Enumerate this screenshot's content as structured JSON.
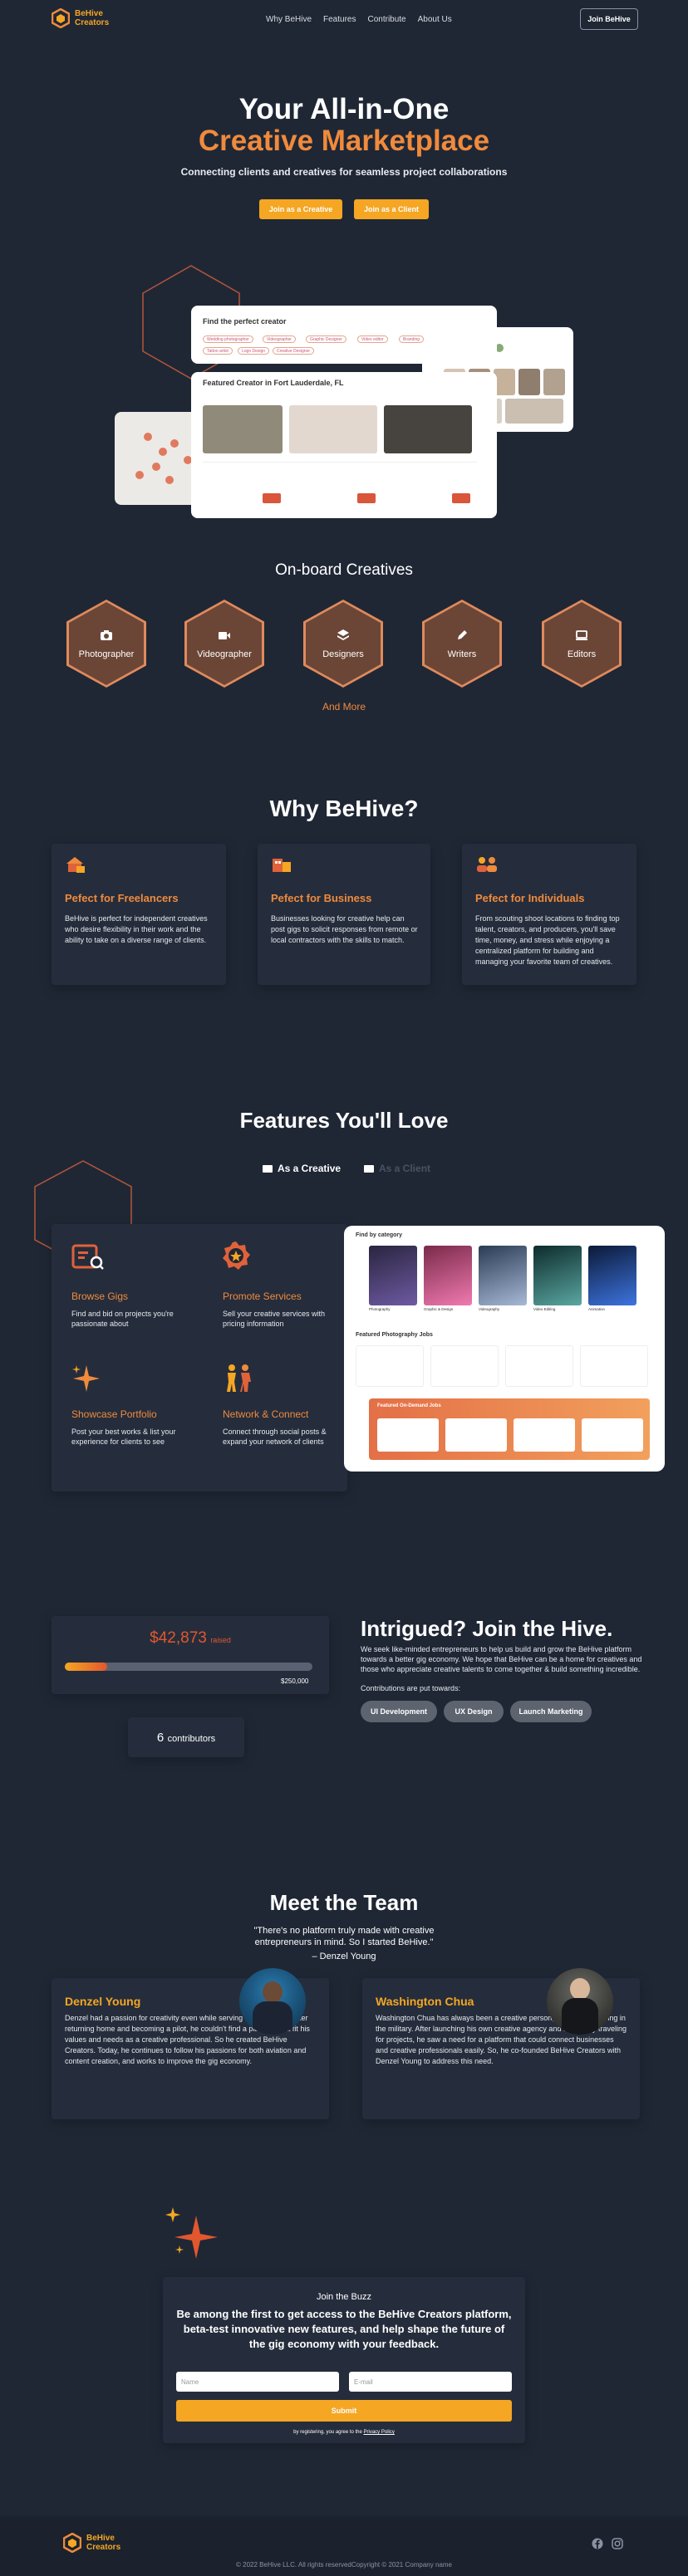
{
  "nav": {
    "brand_line1": "BeHive",
    "brand_line2": "Creators",
    "links": [
      "Why BeHive",
      "Features",
      "Contribute",
      "About Us"
    ],
    "join_label": "Join BeHive"
  },
  "hero": {
    "title_line1": "Your All-in-One",
    "title_line2": "Creative Marketplace",
    "subtitle": "Connecting clients and creatives for seamless project collaborations",
    "btn_creative": "Join as a Creative",
    "btn_client": "Join as a Client",
    "mock_search_title": "Find the perfect creator",
    "mock_featured_title": "Featured Creator in Fort Lauderdale, FL",
    "chips": [
      "Wedding photographer",
      "Videographer",
      "Graphic Designer",
      "Video editor",
      "Branding",
      "Tattoo artist",
      "Logo Design",
      "Creative Designer"
    ]
  },
  "onboard": {
    "title": "On-board Creatives",
    "items": [
      {
        "label": "Photographer",
        "icon": "camera-icon"
      },
      {
        "label": "Videographer",
        "icon": "video-icon"
      },
      {
        "label": "Designers",
        "icon": "layers-icon"
      },
      {
        "label": "Writers",
        "icon": "pencil-icon"
      },
      {
        "label": "Editors",
        "icon": "monitor-icon"
      }
    ],
    "more": "And More"
  },
  "why": {
    "title": "Why BeHive?",
    "cards": [
      {
        "title": "Pefect for Freelancers",
        "text": "BeHive is perfect for independent creatives who desire flexibility in their work and the ability to take on a diverse range of clients."
      },
      {
        "title": "Pefect for Business",
        "text": "Businesses looking for creative help can post gigs to solicit responses from remote or local contractors with the skills to match."
      },
      {
        "title": "Pefect for Individuals",
        "text": "From scouting shoot locations to finding top talent, creators, and producers, you'll save time, money, and stress while enjoying a centralized platform for building and managing your favorite team of creatives."
      }
    ]
  },
  "features": {
    "title": "Features You'll Love",
    "tab_creative": "As a Creative",
    "tab_client": "As a Client",
    "items": [
      {
        "title": "Browse Gigs",
        "text": "Find and bid on projects you're passionate about"
      },
      {
        "title": "Promote Services",
        "text": "Sell your creative services with pricing information"
      },
      {
        "title": "Showcase Portfolio",
        "text": "Post your best works & list your experience for clients to see"
      },
      {
        "title": "Network & Connect",
        "text": "Connect through social posts & expand your network of clients"
      }
    ],
    "mock": {
      "category_title": "Find by category",
      "categories": [
        "Photography",
        "Graphic & Design",
        "Videography",
        "Video Editing",
        "Animation"
      ],
      "jobs_title": "Featured Photography Jobs",
      "banner_title": "Featured On-Demand Jobs"
    }
  },
  "raise": {
    "amount": "$42,873",
    "raised_label": "raised",
    "goal": "$250,000",
    "progress": 0.17,
    "contributors_count": "6",
    "contributors_label": "contributors"
  },
  "join": {
    "title": "Intrigued? Join the Hive.",
    "text": "We seek like-minded entrepreneurs to help us build and grow the BeHive platform towards a better gig economy. We hope that BeHive can be a home for creatives and those who appreciate creative talents to come together & build something incredible.",
    "contrib_label": "Contributions are put towards:",
    "pills": [
      "UI Development",
      "UX Design",
      "Launch Marketing"
    ]
  },
  "team": {
    "title": "Meet the Team",
    "quote": "\"There's no platform truly made with creative entrepreneurs in mind. So I started BeHive.\"",
    "quote_author": "– Denzel Young",
    "members": [
      {
        "name": "Denzel Young",
        "bio": "Denzel had a passion for creativity even while serving in the military. After returning home and becoming a pilot, he couldn't find a platform that fit his values and needs as a creative professional. So he created BeHive Creators. Today, he continues to follow his passions for both aviation and content creation, and works to improve the gig economy."
      },
      {
        "name": "Washington Chua",
        "bio": "Washington Chua has always been a creative person, even while serving in the military. After launching his own creative agency and frequently traveling for projects, he saw a need for a platform that could connect businesses and creative professionals easily. So, he co-founded BeHive Creators with Denzel Young to address this need."
      }
    ]
  },
  "buzz": {
    "title": "Join the Buzz",
    "heading": "Be among the first to get access to the BeHive Creators platform, beta-test innovative new features, and help shape the future of the gig economy with your feedback.",
    "name_placeholder": "Name",
    "email_placeholder": "E-mail",
    "submit": "Submit",
    "terms_prefix": "by registering, you agree to the",
    "terms_link": "Privacy Policy"
  },
  "footer": {
    "brand_line1": "BeHive",
    "brand_line2": "Creators",
    "copyright": "© 2022 BeHive LLC. All rights reservedCopyright © 2021 Company name"
  },
  "colors": {
    "background": "#1f2735",
    "accent_orange": "#f08a3c",
    "accent_yellow": "#f5a623",
    "hex_fill": "#6b4637"
  }
}
